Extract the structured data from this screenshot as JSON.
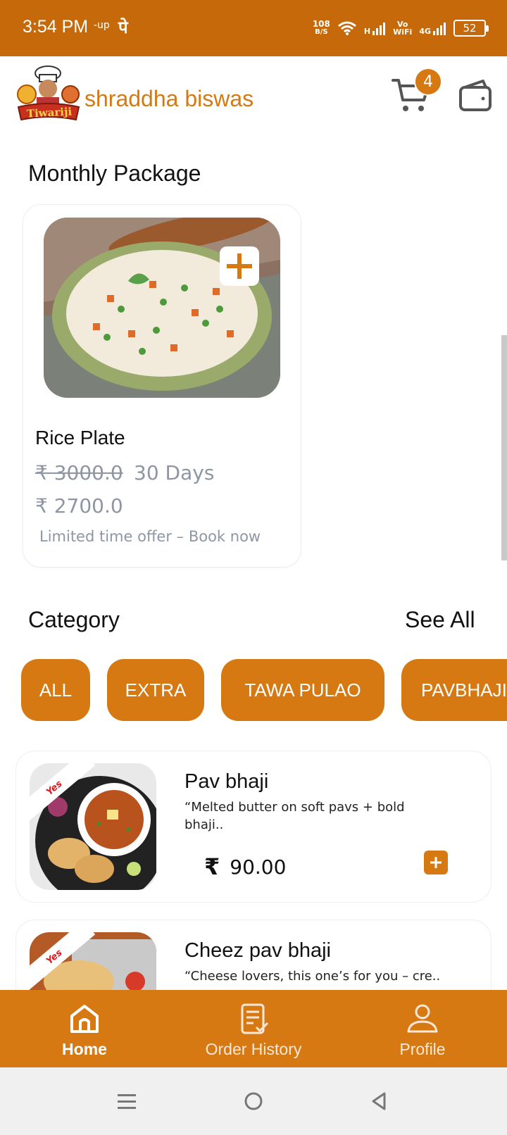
{
  "status_bar": {
    "time": "3:54 PM",
    "indicator_small": "-up",
    "indicator_pe": "पे",
    "net_rate_value": "108",
    "net_rate_unit": "B/S",
    "signal_h": "H",
    "vowifi_top": "Vo",
    "vowifi_bottom": "WiFi",
    "signal_4g": "4G",
    "battery": "52"
  },
  "header": {
    "logo_text": "Tiwariji",
    "user_name": "shraddha biswas",
    "cart_count": "4"
  },
  "monthly_package": {
    "title": "Monthly Package",
    "card": {
      "name": "Rice Plate",
      "old_price": "₹ 3000.0",
      "duration": "30 Days",
      "price": "₹ 2700.0",
      "offer": "Limited time offer –  Book now"
    }
  },
  "category": {
    "title": "Category",
    "see_all": "See All",
    "chips": [
      "ALL",
      "EXTRA",
      "TAWA PULAO",
      "PAVBHAJI"
    ]
  },
  "items": [
    {
      "badge": "Yes",
      "name": "Pav bhaji",
      "desc": "“Melted butter on soft pavs + bold bhaji..",
      "currency": "₹",
      "price": "90.00"
    },
    {
      "badge": "Yes",
      "name": "Cheez pav bhaji",
      "desc": "“Cheese lovers, this one’s for you – cre.."
    }
  ],
  "bottom_nav": {
    "home": "Home",
    "order_history": "Order History",
    "profile": "Profile"
  },
  "colors": {
    "brand": "#d67912",
    "status_bar": "#c5690a",
    "muted_text": "#8e96a4"
  }
}
